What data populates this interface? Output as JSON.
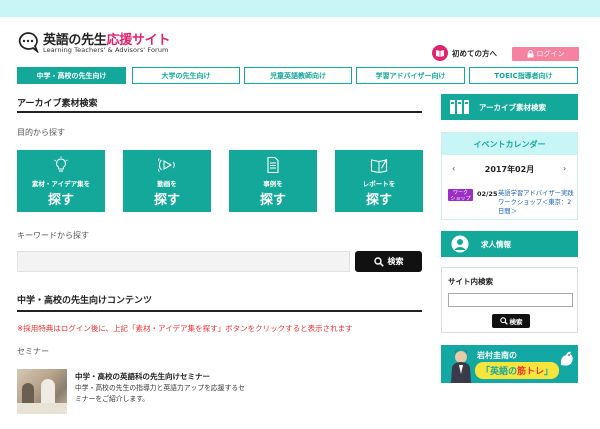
{
  "header": {
    "logo_title_main": "英語の先生",
    "logo_title_accent": "応援サイト",
    "logo_subtitle": "Learning Teachers' & Advisors' Forum",
    "first_visit_label": "初めての方へ",
    "login_label": "ログイン"
  },
  "nav": {
    "tabs": [
      {
        "label": "中学・高校の先生向け",
        "active": true
      },
      {
        "label": "大学の先生向け",
        "active": false
      },
      {
        "label": "児童英語教師向け",
        "active": false
      },
      {
        "label": "学習アドバイザー向け",
        "active": false
      },
      {
        "label": "TOEIC指導者向け",
        "active": false
      }
    ]
  },
  "archive": {
    "title": "アーカイブ素材検索",
    "purpose_label": "目的から探す",
    "boxes": [
      {
        "icon": "lightbulb-icon",
        "label": "素材・アイデア集を",
        "action": "探す"
      },
      {
        "icon": "video-icon",
        "label": "動画を",
        "action": "探す"
      },
      {
        "icon": "document-icon",
        "label": "事例を",
        "action": "探す"
      },
      {
        "icon": "report-icon",
        "label": "レポートを",
        "action": "探す"
      }
    ],
    "keyword_label": "キーワードから探す",
    "keyword_value": "",
    "search_button": "検索"
  },
  "contents": {
    "title": "中学・高校の先生向けコンテンツ",
    "note": "※採用特典はログイン後に、上記「素材・アイデア集を探す」ボタンをクリックすると表示されます",
    "seminar_label": "セミナー",
    "seminar_title": "中学・高校の英語科の先生向けセミナー",
    "seminar_desc": "中学・高校の先生の指導力と英語力アップを応援するセミナーをご紹介します。"
  },
  "sidebar": {
    "archive_banner": "アーカイブ素材検索",
    "event": {
      "title": "イベントカレンダー",
      "month": "2017年02月",
      "prev": "‹",
      "next": "›",
      "badge": "ワーク\nショップ",
      "date": "02/25",
      "text": "英語学習アドバイザー実践ワークショップ＜東京：2日間＞"
    },
    "jobs_banner": "求人情報",
    "site_search": {
      "label": "サイト内検索",
      "value": "",
      "button": "検索"
    },
    "promo": {
      "line1": "岩村圭南の",
      "pill_main": "「英語の",
      "pill_accent": "筋トレ",
      "pill_end": "」"
    }
  },
  "colors": {
    "teal": "#14a89a",
    "light_teal": "#c8f5f5",
    "pink": "#e0246e",
    "login_pink": "#f5829e",
    "note_red": "#e33333",
    "workshop_purple": "#9b2fc3"
  }
}
